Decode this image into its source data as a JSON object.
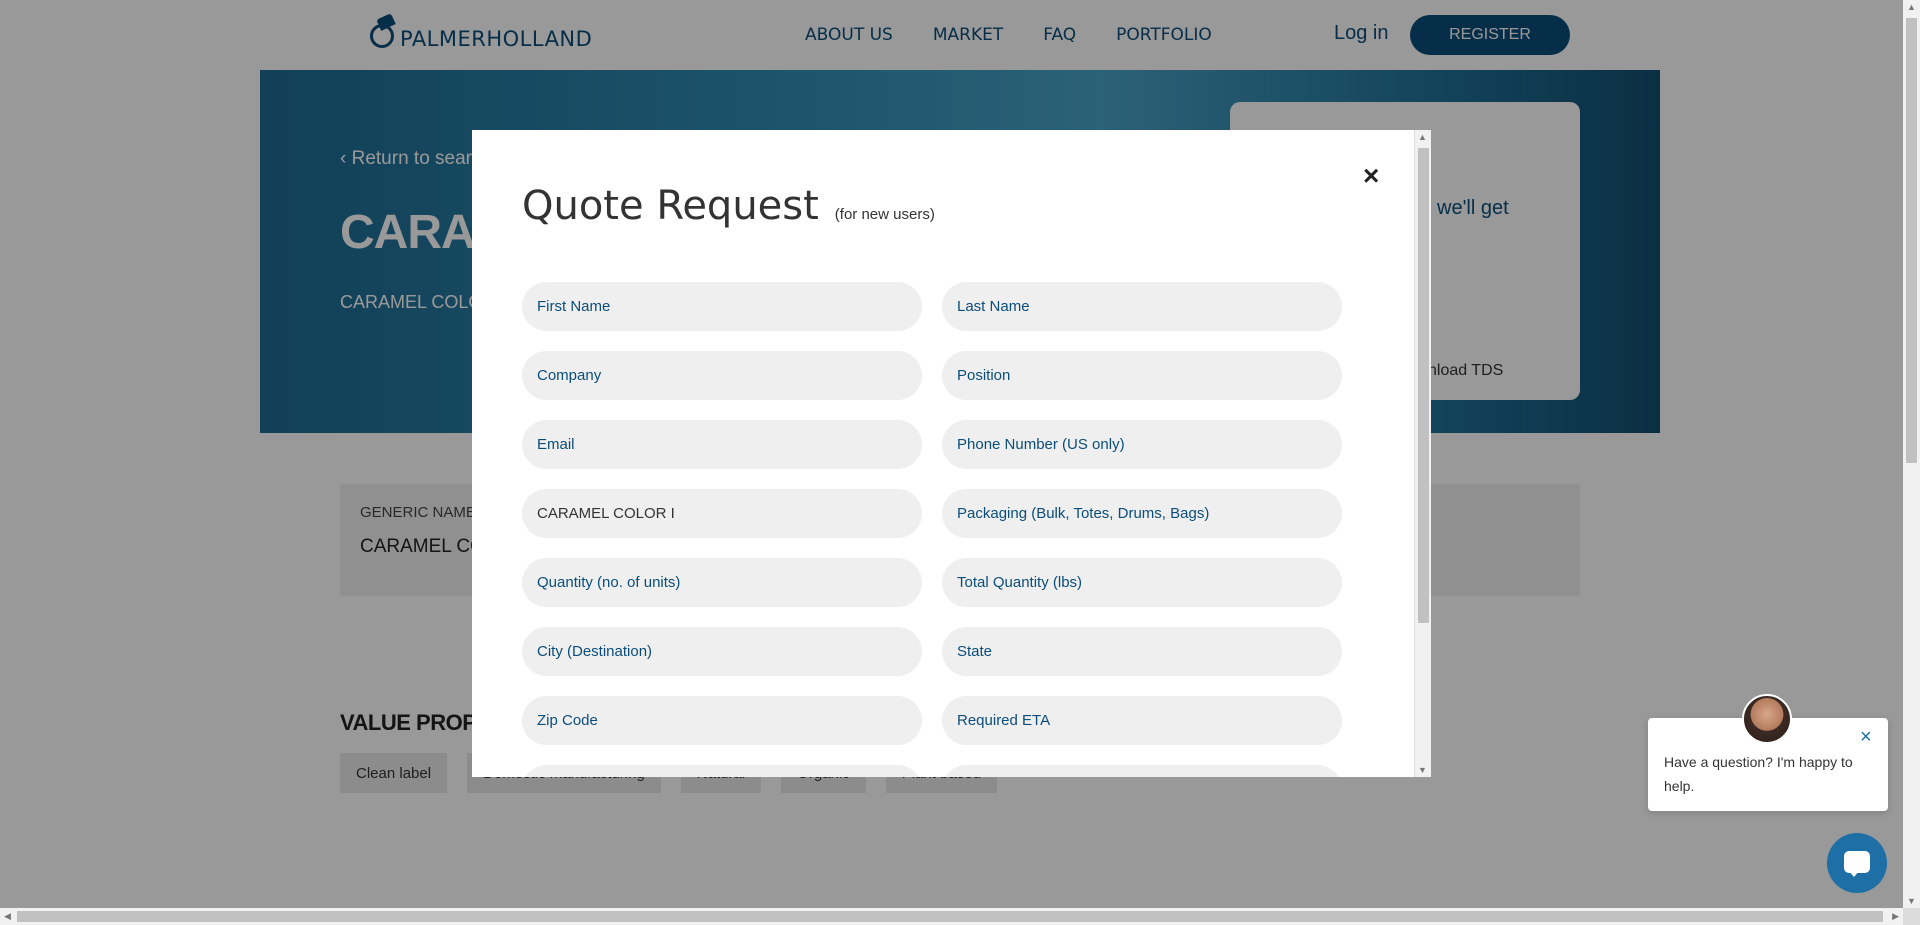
{
  "header": {
    "logo_text": "PALMERHOLLAND",
    "nav": [
      "ABOUT US",
      "MARKET",
      "FAQ",
      "PORTFOLIO"
    ],
    "login": "Log in",
    "register": "REGISTER"
  },
  "hero": {
    "back_link": "‹ Return to searc",
    "title": "CARAME",
    "description": "CARAMEL COLO transparent dar",
    "card_text": "we'll get",
    "card_download": "nload TDS"
  },
  "generic": {
    "label": "GENERIC NAME",
    "value": "CARAMEL CO"
  },
  "value_props": {
    "title": "VALUE PROPOSIT",
    "tags": [
      "Clean label",
      "Domestic manufacturing",
      "Natural",
      "Organic",
      "Plant based"
    ]
  },
  "modal": {
    "title": "Quote Request",
    "subtitle": "(for new users)",
    "close": "×",
    "fields": [
      {
        "placeholder": "First Name",
        "value": ""
      },
      {
        "placeholder": "Last Name",
        "value": ""
      },
      {
        "placeholder": "Company",
        "value": ""
      },
      {
        "placeholder": "Position",
        "value": ""
      },
      {
        "placeholder": "Email",
        "value": ""
      },
      {
        "placeholder": "Phone Number (US only)",
        "value": ""
      },
      {
        "placeholder": "",
        "value": "CARAMEL COLOR I"
      },
      {
        "placeholder": "Packaging (Bulk, Totes, Drums, Bags)",
        "value": ""
      },
      {
        "placeholder": "Quantity (no. of units)",
        "value": ""
      },
      {
        "placeholder": "Total Quantity (lbs)",
        "value": ""
      },
      {
        "placeholder": "City (Destination)",
        "value": ""
      },
      {
        "placeholder": "State",
        "value": ""
      },
      {
        "placeholder": "Zip Code",
        "value": ""
      },
      {
        "placeholder": "Required ETA",
        "value": ""
      }
    ]
  },
  "chat": {
    "message": "Have a question? I'm happy to help.",
    "close": "×"
  }
}
